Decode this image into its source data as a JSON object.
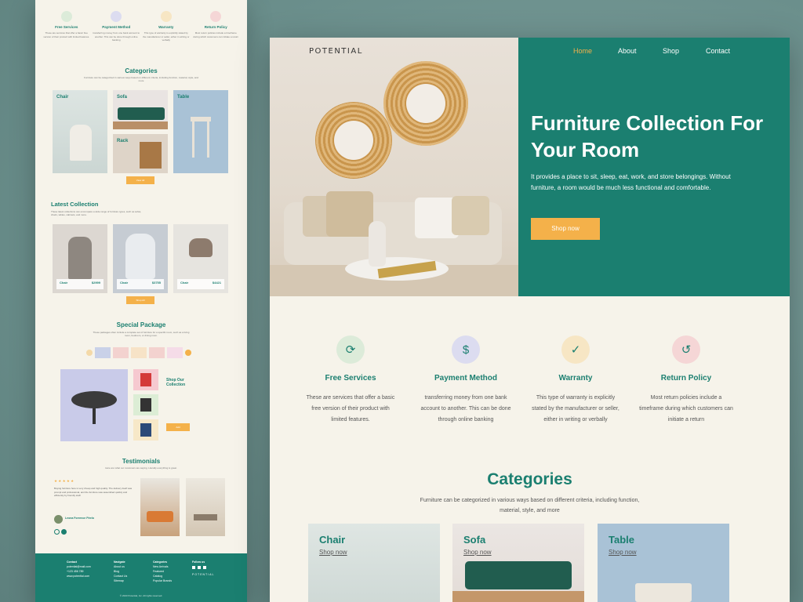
{
  "colors": {
    "teal": "#1b7f70",
    "accent": "#f4b14a",
    "cream": "#f6f3ea"
  },
  "mini": {
    "features": [
      {
        "title": "Free Services",
        "desc": "These are services that offer a basic free version of their product with limited features.",
        "icon": "free-services-icon"
      },
      {
        "title": "Payment Method",
        "desc": "transferring money from one bank account to another. This can be done through online banking",
        "icon": "payment-icon"
      },
      {
        "title": "Warranty",
        "desc": "This type of warranty is explicitly stated by the manufacturer or seller, either in writing or verbally",
        "icon": "warranty-icon"
      },
      {
        "title": "Return Policy",
        "desc": "Most return policies include a timeframe during which customers can initiate a return",
        "icon": "return-icon"
      }
    ],
    "categories_title": "Categories",
    "categories_sub": "Furniture can be categorized in various ways based on different criteria, including function, material, style, and more",
    "cards": [
      {
        "name": "Chair",
        "link": "Shop now"
      },
      {
        "name": "Sofa",
        "link": "Shop now"
      },
      {
        "name": "Table",
        "link": "Shop now"
      },
      {
        "name": "Rack",
        "link": "Shop now"
      }
    ],
    "see_all": "View All",
    "latest_title": "Latest Collection",
    "latest_sub": "These latest collections can encompass a wide range of furniture types, such as sofas, chairs, tables, cabinets, and more.",
    "latest": [
      {
        "name": "Chair",
        "price": "$2999"
      },
      {
        "name": "Chair",
        "price": "$3755"
      },
      {
        "name": "Chair",
        "price": "$4421"
      }
    ],
    "latest_btn": "Shop All",
    "package_title": "Special Package",
    "package_sub": "These packages often include a complete set of furniture for a specific room, such as a living room, bedroom, or dining room.",
    "shop_collection": "Shop Our Collection",
    "package_btn": "Add",
    "testimonials_title": "Testimonials",
    "testimonials_sub": "Here are what our customers are saying. Literally everything is great.",
    "stars": "★ ★ ★ ★ ★",
    "testimonial_text": "Buying furniture here is very cheap and high quality. The delivery itself was prompt and professional, and the furniture was assembled quickly and efficiently by friendly staff.",
    "reviewer": "Leona Forrence Pirelo",
    "footer": {
      "contact": [
        "Contact",
        "potential@mail.com",
        "+123 456 789",
        "www.potential.com"
      ],
      "navigate": [
        "Navigate",
        "About us",
        "Blog",
        "Contact Us",
        "Sitemap"
      ],
      "categories": [
        "Categories",
        "New Arrivals",
        "Featured",
        "Catalog",
        "Popular Brands"
      ],
      "follow": [
        "Follow us"
      ],
      "logo": "POTENTIAL",
      "copyright": "© 2023 Potential, Inc. All rights reserved."
    }
  },
  "main": {
    "logo": "POTENTIAL",
    "nav": [
      "Home",
      "About",
      "Shop",
      "Contact"
    ],
    "hero_title": "Furniture Collection For Your Room",
    "hero_desc": "It provides a place to sit, sleep, eat, work, and store belongings. Without furniture, a room would be much less functional and comfortable.",
    "hero_btn": "Shop now",
    "features": [
      {
        "title": "Free Services",
        "desc": "These are services that offer a basic free version of their product with limited features.",
        "icon": "free-services-icon"
      },
      {
        "title": "Payment Method",
        "desc": "transferring money from one bank account to another. This can be done through online banking",
        "icon": "payment-icon"
      },
      {
        "title": "Warranty",
        "desc": "This type of warranty is explicitly stated by the manufacturer or seller, either in writing or verbally",
        "icon": "warranty-icon"
      },
      {
        "title": "Return Policy",
        "desc": "Most return policies include a timeframe during which customers can initiate a return",
        "icon": "return-icon"
      }
    ],
    "categories_title": "Categories",
    "categories_sub": "Furniture can be categorized in various ways based on different criteria, including function, material, style, and more",
    "cards": [
      {
        "name": "Chair",
        "link": "Shop now"
      },
      {
        "name": "Sofa",
        "link": "Shop now"
      },
      {
        "name": "Table",
        "link": "Shop now"
      }
    ]
  }
}
